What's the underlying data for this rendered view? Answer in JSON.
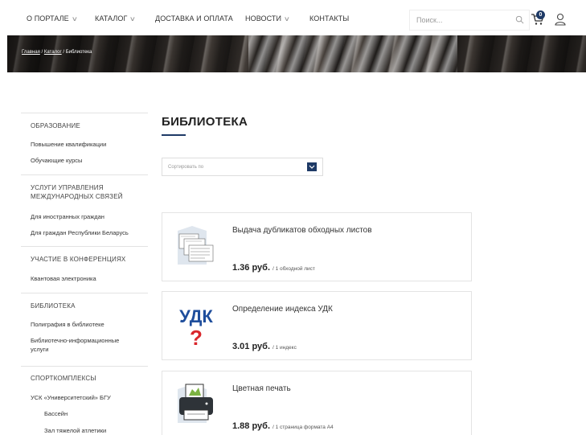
{
  "nav": {
    "items": [
      {
        "label": "О ПОРТАЛЕ",
        "dropdown": true
      },
      {
        "label": "КАТАЛОГ",
        "dropdown": true
      },
      {
        "label": "ДОСТАВКА И ОПЛАТА",
        "dropdown": false
      },
      {
        "label": "НОВОСТИ",
        "dropdown": true
      },
      {
        "label": "КОНТАКТЫ",
        "dropdown": false
      }
    ],
    "search_placeholder": "Поиск...",
    "cart_count": "0"
  },
  "breadcrumb": {
    "home": "Главная",
    "sep1": " / ",
    "catalog": "Каталог",
    "sep2": " / ",
    "current": "Библиотека"
  },
  "sidebar": {
    "sections": [
      {
        "title": "ОБРАЗОВАНИЕ",
        "links": [
          "Повышение квалификации",
          "Обучающие курсы"
        ]
      },
      {
        "title": "УСЛУГИ УПРАВЛЕНИЯ МЕЖДУНАРОДНЫХ СВЯЗЕЙ",
        "links": [
          "Для иностранных граждан",
          "Для граждан Республики Беларусь"
        ]
      },
      {
        "title": "УЧАСТИЕ В КОНФЕРЕНЦИЯХ",
        "links": [
          "Квантовая электроника"
        ]
      },
      {
        "title": "БИБЛИОТЕКА",
        "links": [
          "Полиграфия в библиотеке",
          "Библиотечно-информационные услуги"
        ]
      },
      {
        "title": "СПОРТКОМПЛЕКСЫ",
        "links": [
          "УСК «Университетский» БГУ",
          "Бассейн",
          "Зал тяжелой атлетики"
        ]
      }
    ]
  },
  "main": {
    "title": "БИБЛИОТЕКА",
    "sort_label": "Сортировать по",
    "products": [
      {
        "title": "Выдача дубликатов обходных листов",
        "price": "1.36 руб.",
        "unit": "/ 1 обходной лист",
        "icon": "document-sheets-icon"
      },
      {
        "title": "Определение индекса УДК",
        "price": "3.01 руб.",
        "unit": "/ 1 индекс",
        "icon": "udk-question-icon",
        "icon_text": "УДК"
      },
      {
        "title": "Цветная печать",
        "price": "1.88 руб.",
        "unit": "/ 1 страница формата А4",
        "icon": "printer-icon"
      }
    ]
  },
  "colors": {
    "accent": "#1e3a66",
    "border": "#e4e4e4",
    "udk_blue": "#1f4e9c",
    "udk_red": "#d9262b"
  }
}
